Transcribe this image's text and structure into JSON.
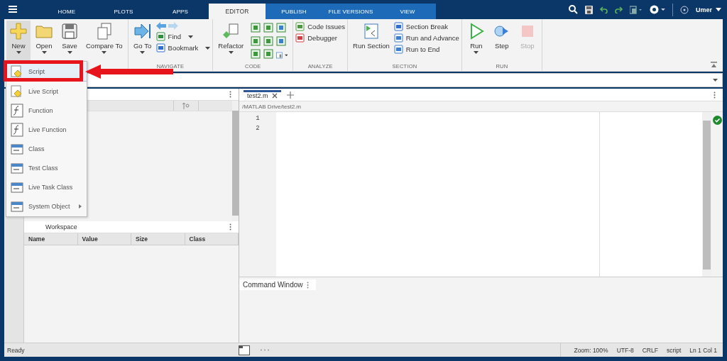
{
  "toolstrip_tabs": [
    {
      "label": "HOME",
      "selected": false,
      "kind": "main"
    },
    {
      "label": "PLOTS",
      "selected": false,
      "kind": "main"
    },
    {
      "label": "APPS",
      "selected": false,
      "kind": "main"
    },
    {
      "label": "EDITOR",
      "selected": true,
      "kind": "contextual"
    },
    {
      "label": "PUBLISH",
      "selected": false,
      "kind": "contextual"
    },
    {
      "label": "FILE VERSIONS",
      "selected": false,
      "kind": "contextual"
    },
    {
      "label": "VIEW",
      "selected": false,
      "kind": "contextual"
    }
  ],
  "user": "Umer",
  "ribbon_groups": [
    {
      "items": [
        {
          "kind": "large",
          "label": "New",
          "dropdown": true,
          "selected": true
        },
        {
          "kind": "large",
          "label": "Open",
          "dropdown": true,
          "selected": false
        },
        {
          "kind": "large",
          "label": "Save",
          "dropdown": true,
          "selected": false
        },
        {
          "kind": "large",
          "label": "Compare To",
          "dropdown": true,
          "selected": false
        }
      ]
    },
    {
      "label": "NAVIGATE",
      "items": [
        {
          "kind": "large",
          "label": "Go To",
          "dropdown": true,
          "selected": false
        },
        {
          "kind": "column",
          "items": [
            {
              "kind": "arrows"
            },
            {
              "kind": "small",
              "label": "Find",
              "dropdown": true
            },
            {
              "kind": "small",
              "label": "Bookmark",
              "dropdown": true
            }
          ]
        }
      ]
    },
    {
      "label": "CODE",
      "items": [
        {
          "kind": "large",
          "label": "Refactor",
          "dropdown": true,
          "selected": false
        },
        {
          "kind": "icon_grid"
        }
      ]
    },
    {
      "label": "ANALYZE",
      "items": [
        {
          "kind": "column",
          "items": [
            {
              "kind": "small",
              "label": "Code Issues"
            },
            {
              "kind": "small",
              "label": "Debugger"
            }
          ]
        }
      ]
    },
    {
      "label": "SECTION",
      "items": [
        {
          "kind": "large",
          "label": "Run Section",
          "selected": false
        },
        {
          "kind": "column",
          "items": [
            {
              "kind": "small",
              "label": "Section Break"
            },
            {
              "kind": "small",
              "label": "Run and Advance"
            },
            {
              "kind": "small",
              "label": "Run to End"
            }
          ]
        }
      ]
    },
    {
      "label": "RUN",
      "items": [
        {
          "kind": "large",
          "label": "Run",
          "dropdown": true,
          "selected": false
        },
        {
          "kind": "large",
          "label": "Step",
          "selected": false
        },
        {
          "kind": "large",
          "label": "Stop",
          "selected": false,
          "disabled": true
        }
      ]
    }
  ],
  "new_menu": [
    {
      "label": "Script",
      "selected": true
    },
    {
      "label": "Live Script",
      "selected": false
    },
    {
      "label": "Function",
      "selected": false
    },
    {
      "label": "Live Function",
      "selected": false
    },
    {
      "label": "Class",
      "selected": false
    },
    {
      "label": "Test Class",
      "selected": false
    },
    {
      "label": "Live Task Class",
      "selected": false
    },
    {
      "label": "System Object",
      "selected": false,
      "submenu": true
    }
  ],
  "workspace": {
    "title": "Workspace",
    "columns": [
      "Name",
      "Value",
      "Size",
      "Class"
    ]
  },
  "editor": {
    "tabs": [
      {
        "label": "test2.m",
        "selected": true
      }
    ],
    "path": "/MATLAB Drive/test2.m",
    "line_numbers": [
      "1",
      "2"
    ]
  },
  "command_window": {
    "title": "Command Window"
  },
  "status_bar": {
    "left": "Ready",
    "right": [
      "Zoom: 100%",
      "UTF-8",
      "CRLF",
      "script",
      "Ln 1 Col 1"
    ]
  }
}
